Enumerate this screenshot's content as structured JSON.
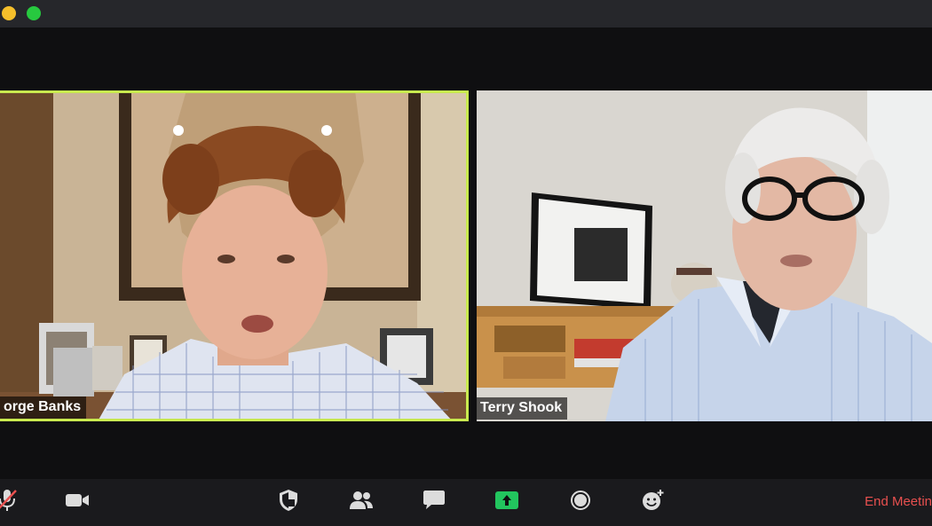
{
  "participants": [
    {
      "name": "orge Banks",
      "active_speaker": true
    },
    {
      "name": "Terry Shook",
      "active_speaker": false
    }
  ],
  "toolbar": {
    "end_meeting_label": "End Meetin",
    "icons": [
      "mic-muted-icon",
      "video-camera-icon",
      "shield-icon",
      "participants-icon",
      "chat-icon",
      "share-screen-icon",
      "record-icon",
      "reactions-icon"
    ]
  },
  "colors": {
    "active_speaker_border": "#c9ea4f",
    "end_meeting": "#e8504f",
    "share_green": "#22c55e"
  }
}
